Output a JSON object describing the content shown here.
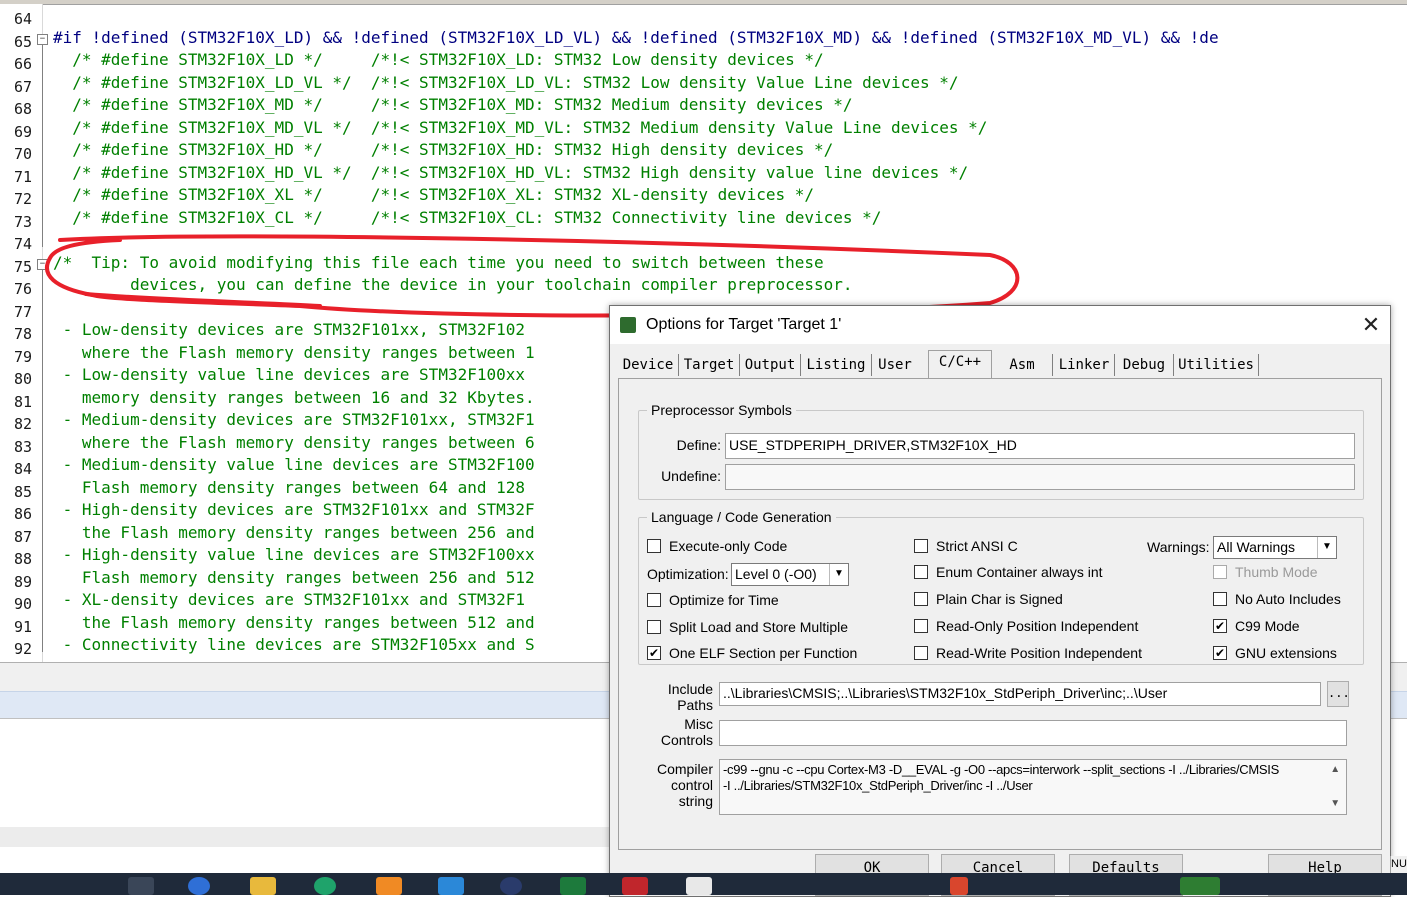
{
  "editor": {
    "lines": [
      {
        "n": "64",
        "text": "",
        "kind": "code"
      },
      {
        "n": "65",
        "text": "#if !defined (STM32F10X_LD) && !defined (STM32F10X_LD_VL) && !defined (STM32F10X_MD) && !defined (STM32F10X_MD_VL) && !de",
        "kind": "pp",
        "fold": "minus"
      },
      {
        "n": "66",
        "text": "  /* #define STM32F10X_LD */     /*!< STM32F10X_LD: STM32 Low density devices */",
        "kind": "code"
      },
      {
        "n": "67",
        "text": "  /* #define STM32F10X_LD_VL */  /*!< STM32F10X_LD_VL: STM32 Low density Value Line devices */",
        "kind": "code"
      },
      {
        "n": "68",
        "text": "  /* #define STM32F10X_MD */     /*!< STM32F10X_MD: STM32 Medium density devices */",
        "kind": "code"
      },
      {
        "n": "69",
        "text": "  /* #define STM32F10X_MD_VL */  /*!< STM32F10X_MD_VL: STM32 Medium density Value Line devices */",
        "kind": "code"
      },
      {
        "n": "70",
        "text": "  /* #define STM32F10X_HD */     /*!< STM32F10X_HD: STM32 High density devices */",
        "kind": "code"
      },
      {
        "n": "71",
        "text": "  /* #define STM32F10X_HD_VL */  /*!< STM32F10X_HD_VL: STM32 High density value line devices */",
        "kind": "code"
      },
      {
        "n": "72",
        "text": "  /* #define STM32F10X_XL */     /*!< STM32F10X_XL: STM32 XL-density devices */",
        "kind": "code"
      },
      {
        "n": "73",
        "text": "  /* #define STM32F10X_CL */     /*!< STM32F10X_CL: STM32 Connectivity line devices */",
        "kind": "code"
      },
      {
        "n": "74",
        "text": "",
        "kind": "code"
      },
      {
        "n": "75",
        "text": "/*  Tip: To avoid modifying this file each time you need to switch between these",
        "kind": "code",
        "fold": "minus"
      },
      {
        "n": "76",
        "text": "        devices, you can define the device in your toolchain compiler preprocessor.",
        "kind": "code"
      },
      {
        "n": "77",
        "text": "",
        "kind": "code"
      },
      {
        "n": "78",
        "text": " - Low-density devices are STM32F101xx, STM32F102",
        "kind": "code"
      },
      {
        "n": "79",
        "text": "   where the Flash memory density ranges between 1",
        "kind": "code"
      },
      {
        "n": "80",
        "text": " - Low-density value line devices are STM32F100xx",
        "kind": "code"
      },
      {
        "n": "81",
        "text": "   memory density ranges between 16 and 32 Kbytes.",
        "kind": "code"
      },
      {
        "n": "82",
        "text": " - Medium-density devices are STM32F101xx, STM32F1",
        "kind": "code"
      },
      {
        "n": "83",
        "text": "   where the Flash memory density ranges between 6",
        "kind": "code"
      },
      {
        "n": "84",
        "text": " - Medium-density value line devices are STM32F100",
        "kind": "code"
      },
      {
        "n": "85",
        "text": "   Flash memory density ranges between 64 and 128",
        "kind": "code"
      },
      {
        "n": "86",
        "text": " - High-density devices are STM32F101xx and STM32F",
        "kind": "code"
      },
      {
        "n": "87",
        "text": "   the Flash memory density ranges between 256 and",
        "kind": "code"
      },
      {
        "n": "88",
        "text": " - High-density value line devices are STM32F100xx",
        "kind": "code"
      },
      {
        "n": "89",
        "text": "   Flash memory density ranges between 256 and 512",
        "kind": "code"
      },
      {
        "n": "90",
        "text": " - XL-density devices are STM32F101xx and STM32F1",
        "kind": "code"
      },
      {
        "n": "91",
        "text": "   the Flash memory density ranges between 512 and",
        "kind": "code"
      },
      {
        "n": "92",
        "text": " - Connectivity line devices are STM32F105xx and S",
        "kind": "code"
      }
    ]
  },
  "dialog": {
    "title": "Options for Target 'Target 1'",
    "close_glyph": "✕",
    "tabs": [
      "Device",
      "Target",
      "Output",
      "Listing",
      "User",
      "C/C++",
      "Asm",
      "Linker",
      "Debug",
      "Utilities"
    ],
    "active_tab": "C/C++",
    "preprocessor": {
      "group_title": "Preprocessor Symbols",
      "define_label": "Define:",
      "define_value": "USE_STDPERIPH_DRIVER,STM32F10X_HD",
      "undefine_label": "Undefine:",
      "undefine_value": ""
    },
    "language": {
      "group_title": "Language / Code Generation",
      "execute_only": {
        "label": "Execute-only Code",
        "checked": false
      },
      "optimization_label": "Optimization:",
      "optimization_value": "Level 0 (-O0)",
      "optimize_time": {
        "label": "Optimize for Time",
        "checked": false
      },
      "split_load": {
        "label": "Split Load and Store Multiple",
        "checked": false
      },
      "one_elf": {
        "label": "One ELF Section per Function",
        "checked": true
      },
      "strict_ansi": {
        "label": "Strict ANSI C",
        "checked": false
      },
      "enum_container": {
        "label": "Enum Container always int",
        "checked": false
      },
      "plain_char": {
        "label": "Plain Char is Signed",
        "checked": false
      },
      "ro_pos": {
        "label": "Read-Only Position Independent",
        "checked": false
      },
      "rw_pos": {
        "label": "Read-Write Position Independent",
        "checked": false
      },
      "warnings_label": "Warnings:",
      "warnings_value": "All Warnings",
      "thumb_mode": {
        "label": "Thumb Mode",
        "checked": false,
        "disabled": true
      },
      "no_auto_includes": {
        "label": "No Auto Includes",
        "checked": false
      },
      "c99_mode": {
        "label": "C99 Mode",
        "checked": true
      },
      "gnu_ext": {
        "label": "GNU extensions",
        "checked": true
      }
    },
    "include_label_1": "Include",
    "include_label_2": "Paths",
    "include_value": "..\\Libraries\\CMSIS;..\\Libraries\\STM32F10x_StdPeriph_Driver\\inc;..\\User",
    "browse_label": "...",
    "misc_label_1": "Misc",
    "misc_label_2": "Controls",
    "misc_value": "",
    "compiler_label_1": "Compiler",
    "compiler_label_2": "control",
    "compiler_label_3": "string",
    "compiler_line_1": "-c99 --gnu -c --cpu Cortex-M3 -D__EVAL -g -O0 --apcs=interwork --split_sections -I ../Libraries/CMSIS",
    "compiler_line_2": "-I ../Libraries/STM32F10x_StdPeriph_Driver/inc -I ../User",
    "buttons": {
      "ok": "OK",
      "cancel": "Cancel",
      "defaults": "Defaults",
      "help": "Help"
    }
  },
  "status_fragment": "NU",
  "annotation_color": "#e8202a",
  "check_glyph": "✔"
}
